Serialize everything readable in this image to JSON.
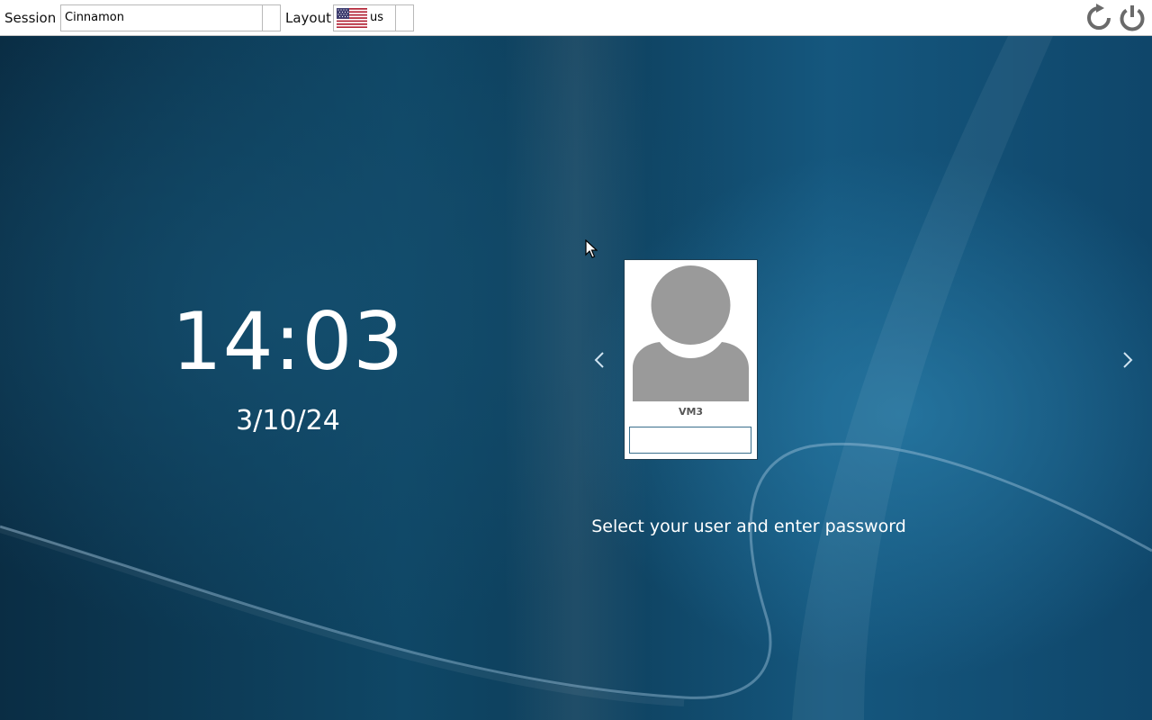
{
  "topbar": {
    "session_label": "Session",
    "session_value": "Cinnamon",
    "layout_label": "Layout",
    "layout_value": "us",
    "layout_flag_icon": "us-flag-icon",
    "restart_icon": "restart-icon",
    "power_icon": "power-icon"
  },
  "clock": {
    "time": "14:03",
    "date": "3/10/24"
  },
  "login": {
    "user_name": "VM3",
    "password_value": "",
    "prompt": "Select your user and enter password",
    "prev_icon": "chevron-left-icon",
    "next_icon": "chevron-right-icon"
  },
  "colors": {
    "background_dark": "#0a2d44",
    "background_light": "#2a7eaa",
    "text_on_background": "#ffffff",
    "avatar_gray": "#9a9a9a",
    "input_border": "#3a6f8c"
  }
}
